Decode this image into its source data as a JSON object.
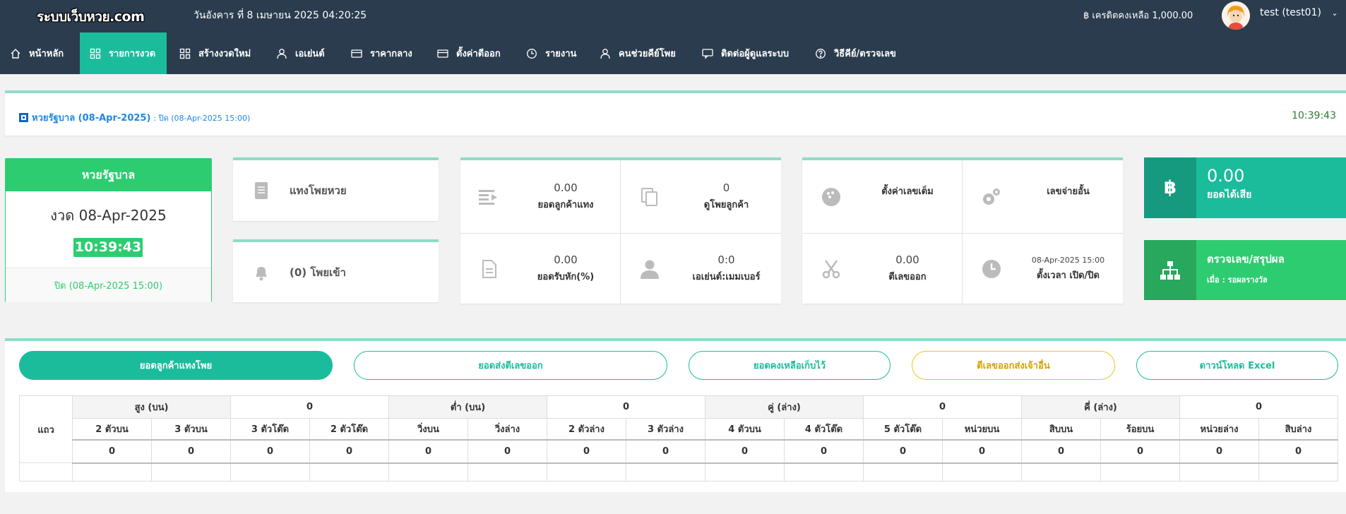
{
  "topbar": {
    "logo": "ระบบเว็บหวย.com",
    "datetime": "วันอังคาร ที่ 8 เมษายน 2025 04:20:25",
    "credit_label": "฿ เครดิตคงเหลือ 1,000.00",
    "user": "test (test01)"
  },
  "nav": {
    "items": [
      {
        "label": "หน้าหลัก",
        "icon": "home-icon"
      },
      {
        "label": "รายการงวด",
        "icon": "grid-icon"
      },
      {
        "label": "สร้างงวดใหม่",
        "icon": "grid-icon"
      },
      {
        "label": "เอเย่นต์",
        "icon": "user-icon"
      },
      {
        "label": "ราคากลาง",
        "icon": "card-icon"
      },
      {
        "label": "ตั้งค่าตีออก",
        "icon": "card-icon"
      },
      {
        "label": "รายงาน",
        "icon": "clock-icon"
      },
      {
        "label": "คนช่วยคีย์โพย",
        "icon": "user-icon"
      },
      {
        "label": "ติดต่อผู้ดูแลระบบ",
        "icon": "chat-icon"
      },
      {
        "label": "วิธีคีย์/ตรวจเลข",
        "icon": "help-icon"
      }
    ]
  },
  "header_panel": {
    "title": "หวยรัฐบาล (08-Apr-2025)",
    "close_text": ": ปิด (08-Apr-2025 15:00)",
    "time": "10:39:43"
  },
  "draw_card": {
    "title": "หวยรัฐบาล",
    "round": "งวด 08-Apr-2025",
    "clock": "10:39:43",
    "close_text": "ปิด (08-Apr-2025 15:00)"
  },
  "cards": {
    "bet_lottery": "แทงโพยหวย",
    "incoming_bets": "(0) โพยเข้า"
  },
  "summary": {
    "customer_bet_value": "0.00",
    "customer_bet_label": "ยอดลูกค้าแทง",
    "view_bets_value": "0",
    "view_bets_label": "ดูโพยลูกค้า",
    "commission_value": "0.00",
    "commission_label": "ยอดรับหัก(%)",
    "agent_member_value": "0:0",
    "agent_member_label": "เอเย่นต์:เมมเบอร์"
  },
  "settings": {
    "full_number_label": "ตั้งค่าเลขเต็ม",
    "payout_limit_label": "เลขจ่ายอั้น",
    "cut_out_value": "0.00",
    "cut_out_label": "ตีเลขออก",
    "schedule_value": "08-Apr-2025 15:00",
    "schedule_label": "ตั้งเวลา เปิด/ปิด"
  },
  "stats": {
    "profit_value": "0.00",
    "profit_label": "ยอดได้เสีย",
    "check_title": "ตรวจเลข/สรุปผล",
    "check_sub": "เมื่อ : รอผลรางวัล"
  },
  "buttons": {
    "customer_bets": "ยอดลูกค้าแทงโพย",
    "sent_out": "ยอดส่งตีเลขออก",
    "kept": "ยอดคงเหลือเก็บไว้",
    "sent_other": "ตีเลขออกส่งเจ้าอื่น",
    "download": "ดาวน์โหลด Excel"
  },
  "table": {
    "row_header": "แถว",
    "groups": [
      {
        "label": "สูง (บน)",
        "value": "0"
      },
      {
        "label": "ต่ำ (บน)",
        "value": "0"
      },
      {
        "label": "คู่ (ล่าง)",
        "value": "0"
      },
      {
        "label": "คี่ (ล่าง)",
        "value": "0"
      }
    ],
    "columns": [
      "2 ตัวบน",
      "3 ตัวบน",
      "3 ตัวโต๊ด",
      "2 ตัวโต๊ด",
      "วิ่งบน",
      "วิ่งล่าง",
      "2 ตัวล่าง",
      "3 ตัวล่าง",
      "4 ตัวบน",
      "4 ตัวโต๊ด",
      "5 ตัวโต๊ด",
      "หน่วยบน",
      "สิบบน",
      "ร้อยบน",
      "หน่วยล่าง",
      "สิบล่าง"
    ],
    "values": [
      "0",
      "0",
      "0",
      "0",
      "0",
      "0",
      "0",
      "0",
      "0",
      "0",
      "0",
      "0",
      "0",
      "0",
      "0",
      "0"
    ]
  }
}
